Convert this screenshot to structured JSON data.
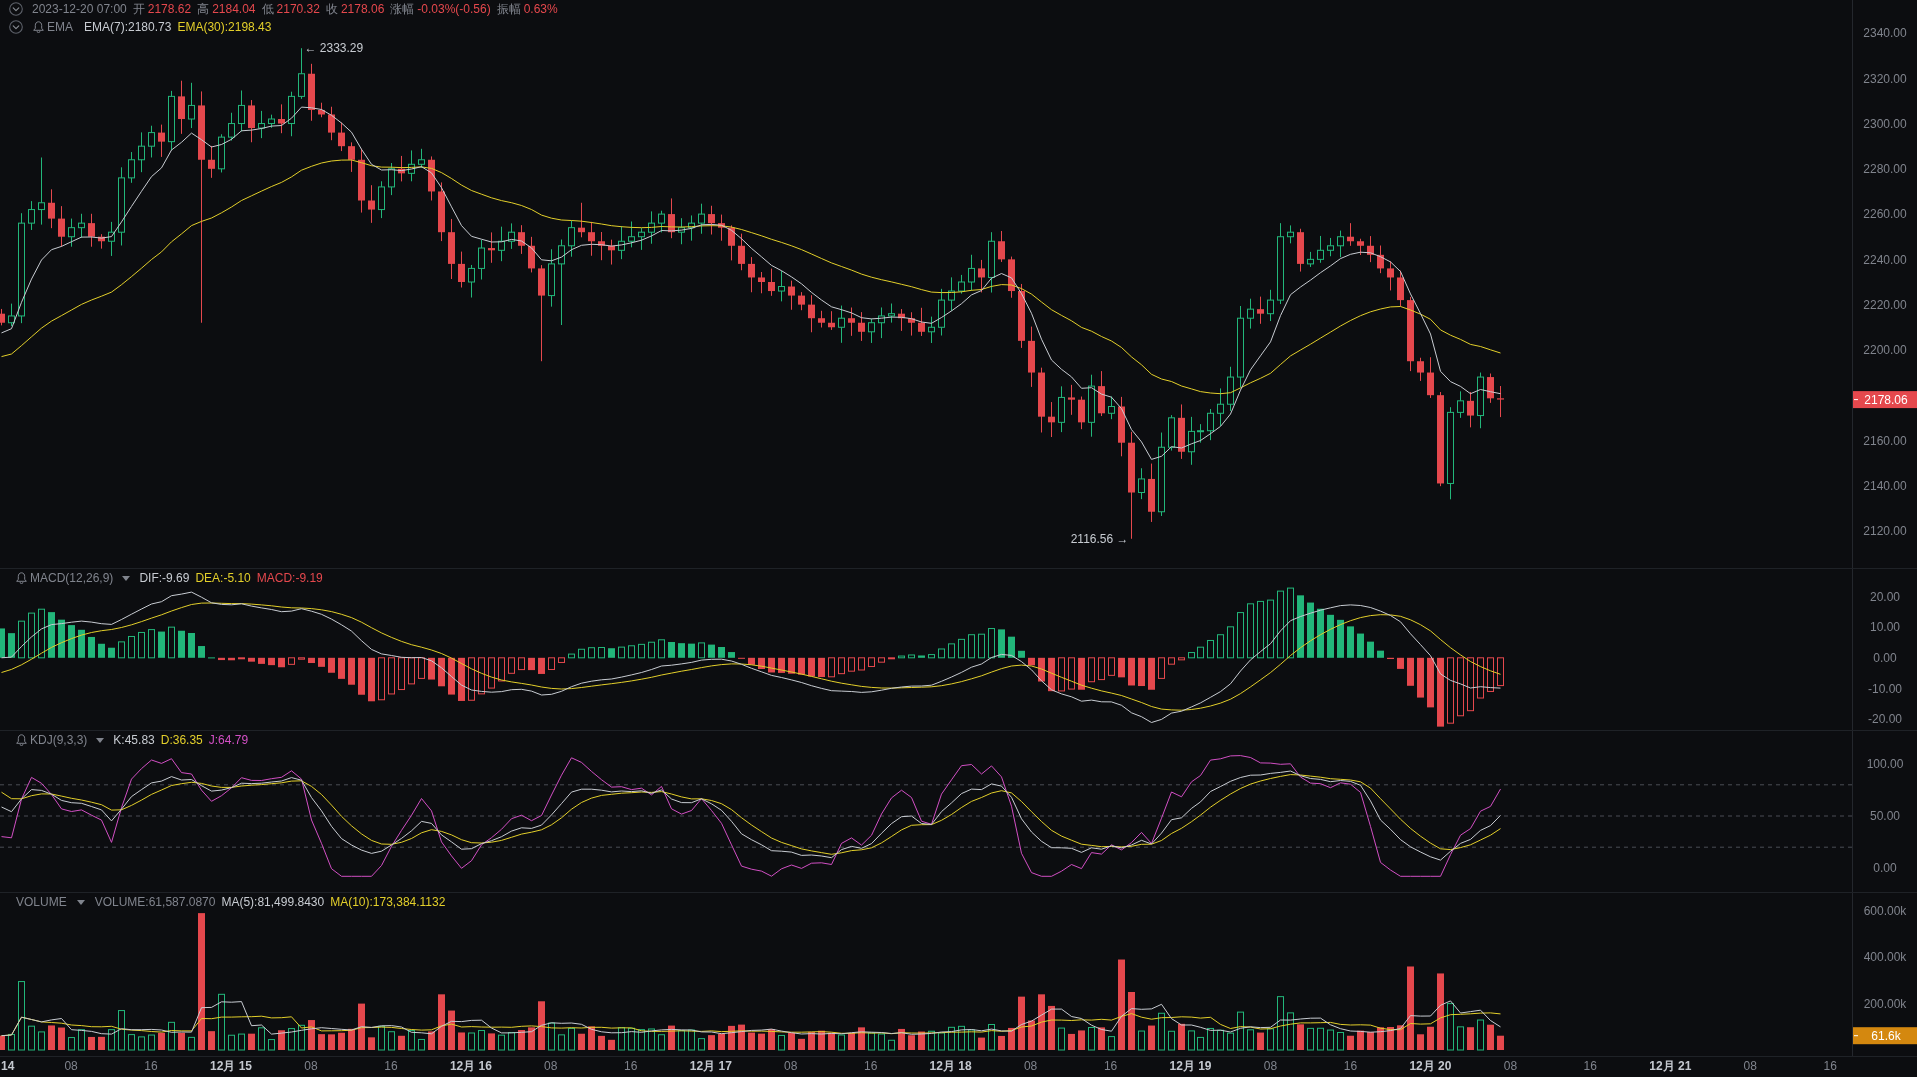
{
  "price_pane": {
    "header": {
      "timestamp": "2023-12-20 07:00",
      "falling": true,
      "fields": [
        {
          "label": "开",
          "value": "2178.62"
        },
        {
          "label": "高",
          "value": "2184.04"
        },
        {
          "label": "低",
          "value": "2170.32"
        },
        {
          "label": "收",
          "value": "2178.06"
        },
        {
          "label": "涨幅",
          "value": "-0.03%(-0.56)"
        },
        {
          "label": "振幅",
          "value": "0.63%"
        }
      ]
    },
    "indicator": {
      "name": "EMA",
      "values": [
        {
          "text": "EMA(7):2180.73",
          "color": "#c8ccd2"
        },
        {
          "text": "EMA(30):2198.43",
          "color": "#e3cf2a"
        }
      ]
    },
    "high_marker": "← 2333.29",
    "low_marker": "2116.56 →",
    "axis_ticks": [
      "2340.00",
      "2320.00",
      "2300.00",
      "2280.00",
      "2260.00",
      "2240.00",
      "2220.00",
      "2200.00",
      "2160.00",
      "2140.00",
      "2120.00"
    ],
    "last_price_tag": "2178.06"
  },
  "macd_pane": {
    "name": "MACD(12,26,9)",
    "values": [
      {
        "text": "DIF:-9.69",
        "color": "#c8ccd2"
      },
      {
        "text": "DEA:-5.10",
        "color": "#e3cf2a"
      },
      {
        "text": "MACD:-9.19",
        "color": "#e5484d"
      }
    ],
    "axis_ticks": [
      "20.00",
      "10.00",
      "0.00",
      "-10.00",
      "-20.00"
    ]
  },
  "kdj_pane": {
    "name": "KDJ(9,3,3)",
    "values": [
      {
        "text": "K:45.83",
        "color": "#c8ccd2"
      },
      {
        "text": "D:36.35",
        "color": "#e3cf2a"
      },
      {
        "text": "J:64.79",
        "color": "#d24fc4"
      }
    ],
    "axis_ticks": [
      "100.00",
      "50.00",
      "0.00"
    ]
  },
  "volume_pane": {
    "name": "VOLUME",
    "values": [
      {
        "text": "VOLUME:61,587.0870",
        "color": "#80848d"
      },
      {
        "text": "MA(5):81,499.8430",
        "color": "#c8ccd2"
      },
      {
        "text": "MA(10):173,384.1132",
        "color": "#e3cf2a"
      }
    ],
    "axis_ticks": [
      "600.00k",
      "400.00k",
      "200.00k"
    ],
    "last_volume_tag": "61.6k"
  },
  "time_axis": [
    {
      "text": "14",
      "kind": "day"
    },
    {
      "text": "08",
      "kind": "hour"
    },
    {
      "text": "16",
      "kind": "hour"
    },
    {
      "text": "12月 15",
      "kind": "day"
    },
    {
      "text": "08",
      "kind": "hour"
    },
    {
      "text": "16",
      "kind": "hour"
    },
    {
      "text": "12月 16",
      "kind": "day"
    },
    {
      "text": "08",
      "kind": "hour"
    },
    {
      "text": "16",
      "kind": "hour"
    },
    {
      "text": "12月 17",
      "kind": "day"
    },
    {
      "text": "08",
      "kind": "hour"
    },
    {
      "text": "16",
      "kind": "hour"
    },
    {
      "text": "12月 18",
      "kind": "day"
    },
    {
      "text": "08",
      "kind": "hour"
    },
    {
      "text": "16",
      "kind": "hour"
    },
    {
      "text": "12月 19",
      "kind": "day"
    },
    {
      "text": "08",
      "kind": "hour"
    },
    {
      "text": "16",
      "kind": "hour"
    },
    {
      "text": "12月 20",
      "kind": "day"
    },
    {
      "text": "08",
      "kind": "hour"
    },
    {
      "text": "16",
      "kind": "hour"
    },
    {
      "text": "12月 21",
      "kind": "day"
    },
    {
      "text": "08",
      "kind": "hour"
    },
    {
      "text": "16",
      "kind": "hour"
    }
  ]
}
